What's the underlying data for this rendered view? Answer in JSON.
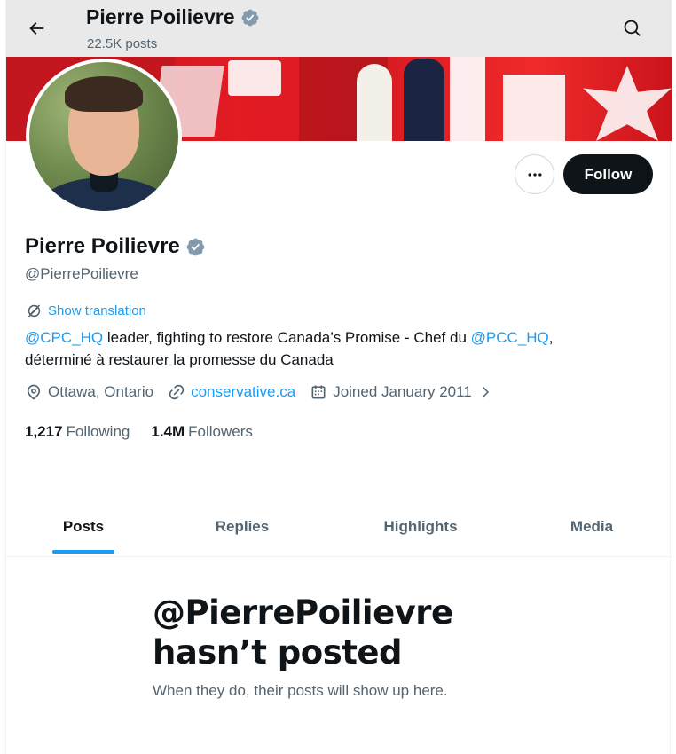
{
  "header": {
    "title": "Pierre Poilievre",
    "post_count": "22.5K posts",
    "back_icon": "arrow-left-icon",
    "search_icon": "search-icon"
  },
  "profile": {
    "name": "Pierre Poilievre",
    "handle": "@PierrePoilievre",
    "verified": true,
    "follow_label": "Follow",
    "more_icon": "more-dots-icon",
    "show_translation": "Show translation",
    "bio": {
      "mention_1": "@CPC_HQ",
      "text_1": " leader, fighting to restore Canada’s Promise - Chef du ",
      "mention_2": "@PCC_HQ",
      "text_2": ",",
      "text_3": "déterminé à restaurer la promesse du Canada"
    },
    "location": "Ottawa, Ontario",
    "website": "conservative.ca",
    "joined": "Joined January 2011",
    "following_count": "1,217",
    "following_label": "Following",
    "followers_count": "1.4M",
    "followers_label": "Followers"
  },
  "tabs": [
    {
      "label": "Posts",
      "active": true
    },
    {
      "label": "Replies",
      "active": false
    },
    {
      "label": "Highlights",
      "active": false
    },
    {
      "label": "Media",
      "active": false
    }
  ],
  "empty_state": {
    "title_line1": "@PierrePoilievre",
    "title_line2": "hasn’t posted",
    "subtitle": "When they do, their posts will show up here."
  },
  "colors": {
    "accent": "#1d9bf0",
    "text": "#0f1419",
    "secondary_text": "#536471",
    "banner_red": "#e31b23",
    "verified_badge": "#829aab"
  }
}
